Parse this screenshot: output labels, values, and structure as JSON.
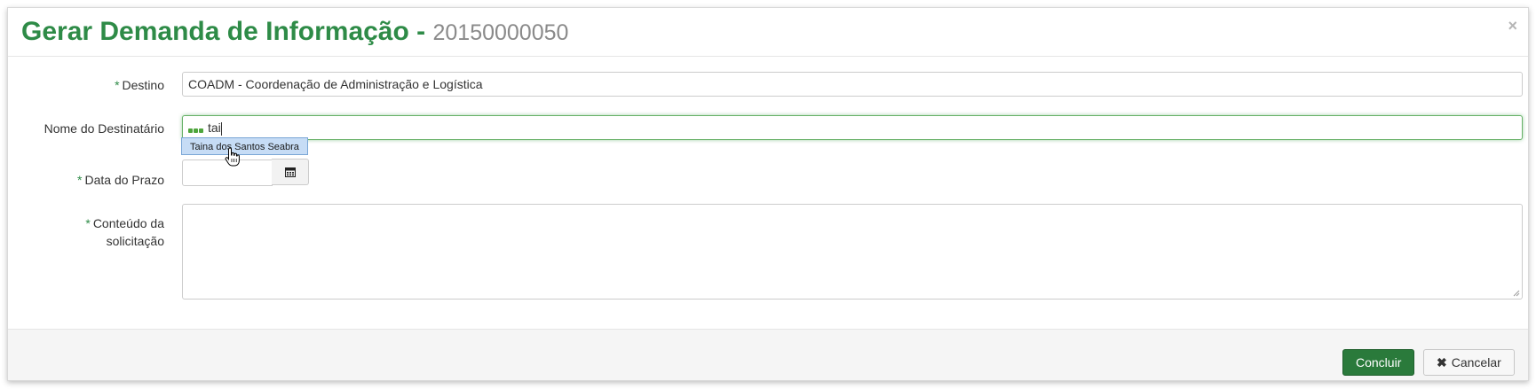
{
  "modal": {
    "title": "Gerar Demanda de Informação - ",
    "subtitle": "20150000050",
    "close_label": "×"
  },
  "form": {
    "destino": {
      "required_mark": "*",
      "label": "Destino",
      "value": "COADM - Coordenação de Administração e Logística"
    },
    "destinatario": {
      "label": "Nome do Destinatário",
      "value": "tai",
      "suggestion": "Taina dos Santos Seabra"
    },
    "prazo": {
      "required_mark": "*",
      "label": "Data do Prazo",
      "value": "",
      "calendar_icon": "calendar-icon"
    },
    "conteudo": {
      "required_mark": "*",
      "label_line1": "Conteúdo da",
      "label_line2": "solicitação",
      "value": ""
    }
  },
  "footer": {
    "submit_label": "Concluir",
    "cancel_icon": "times-icon",
    "cancel_label": "Cancelar"
  },
  "colors": {
    "title_green": "#2e8b47",
    "primary_button": "#2a7a3b"
  }
}
